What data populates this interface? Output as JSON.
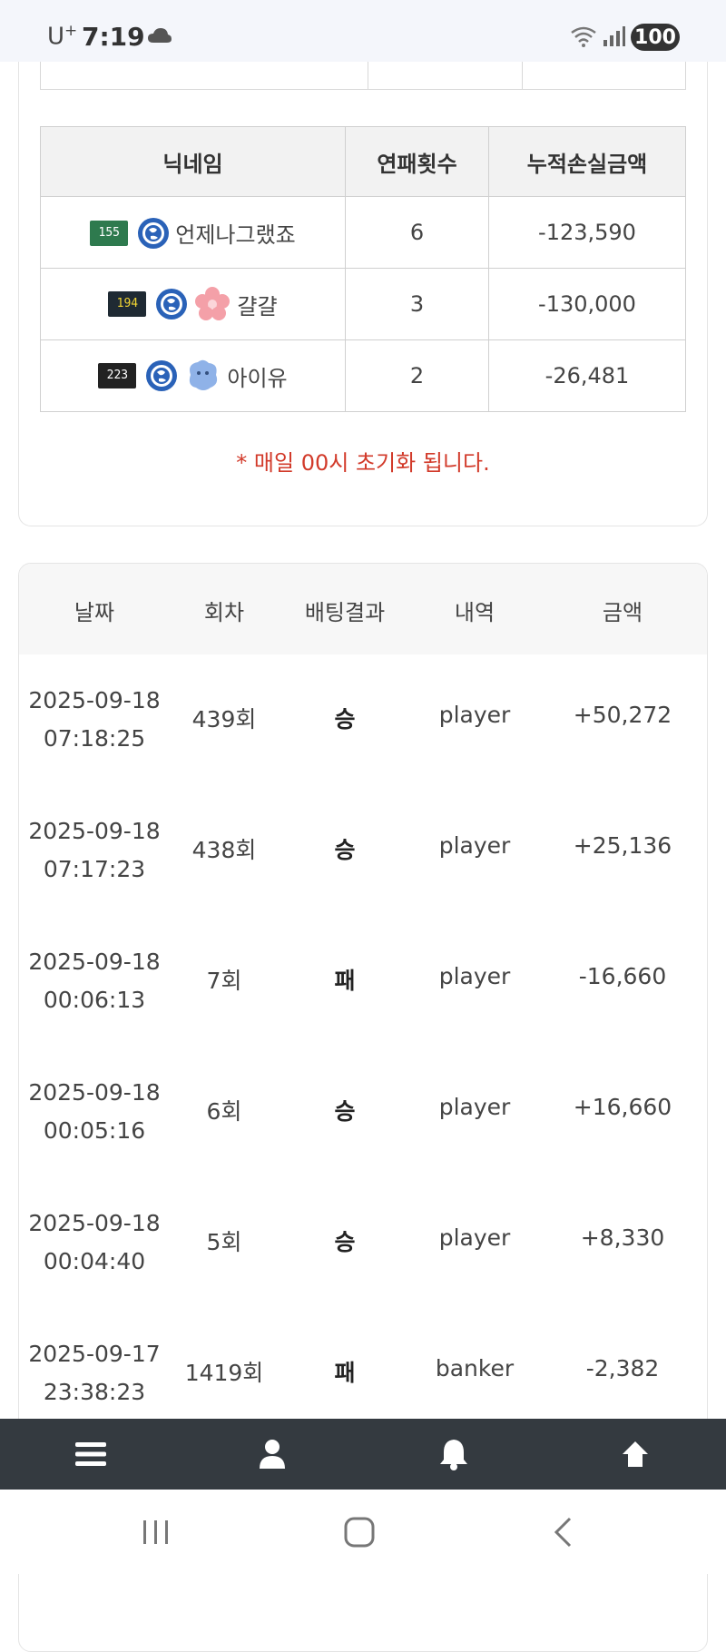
{
  "status_bar": {
    "carrier": "U",
    "carrier_sup": "+",
    "time": "7:19",
    "battery": "100"
  },
  "loss_table": {
    "headers": [
      "닉네임",
      "연패횟수",
      "누적손실금액"
    ],
    "rows": [
      {
        "level": "155",
        "nickname": "언제나그랬죠",
        "streak": "6",
        "total_loss": "-123,590"
      },
      {
        "level": "194",
        "nickname": "걀걀",
        "streak": "3",
        "total_loss": "-130,000"
      },
      {
        "level": "223",
        "nickname": "아이유",
        "streak": "2",
        "total_loss": "-26,481"
      }
    ],
    "notice": "* 매일 00시 초기화 됩니다."
  },
  "history": {
    "headers": [
      "날짜",
      "회차",
      "배팅결과",
      "내역",
      "금액"
    ],
    "rows": [
      {
        "date": "2025-09-18",
        "time": "07:18:25",
        "round": "439회",
        "result": "승",
        "detail": "player",
        "amount": "+50,272"
      },
      {
        "date": "2025-09-18",
        "time": "07:17:23",
        "round": "438회",
        "result": "승",
        "detail": "player",
        "amount": "+25,136"
      },
      {
        "date": "2025-09-18",
        "time": "00:06:13",
        "round": "7회",
        "result": "패",
        "detail": "player",
        "amount": "-16,660"
      },
      {
        "date": "2025-09-18",
        "time": "00:05:16",
        "round": "6회",
        "result": "승",
        "detail": "player",
        "amount": "+16,660"
      },
      {
        "date": "2025-09-18",
        "time": "00:04:40",
        "round": "5회",
        "result": "승",
        "detail": "player",
        "amount": "+8,330"
      },
      {
        "date": "2025-09-17",
        "time": "23:38:23",
        "round": "1419회",
        "result": "패",
        "detail": "banker",
        "amount": "-2,382"
      }
    ]
  },
  "bottom_nav": {
    "icons": [
      "menu-icon",
      "user-icon",
      "bell-icon",
      "arrow-up-icon"
    ]
  },
  "colors": {
    "notice_red": "#d23a2a",
    "nav_bg": "#343a40",
    "header_bg": "#f2f2f2"
  }
}
